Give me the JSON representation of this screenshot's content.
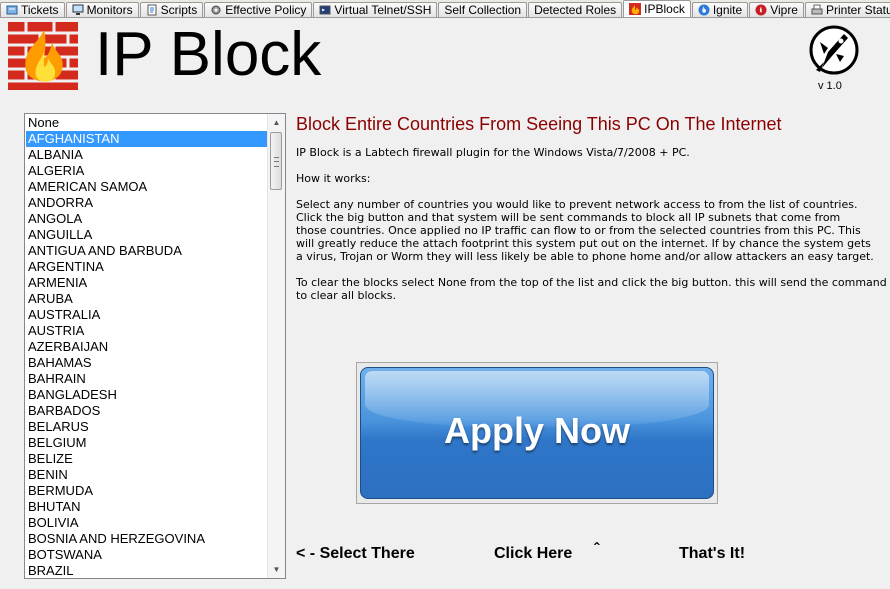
{
  "tabs": [
    {
      "label": "Tickets",
      "icon": "tickets-icon"
    },
    {
      "label": "Monitors",
      "icon": "monitors-icon"
    },
    {
      "label": "Scripts",
      "icon": "scripts-icon"
    },
    {
      "label": "Effective Policy",
      "icon": "policy-icon"
    },
    {
      "label": "Virtual Telnet/SSH",
      "icon": "terminal-icon"
    },
    {
      "label": "Self Collection",
      "icon": ""
    },
    {
      "label": "Detected Roles",
      "icon": ""
    },
    {
      "label": "IPBlock",
      "icon": "ipblock-icon",
      "active": true
    },
    {
      "label": "Ignite",
      "icon": "ignite-icon"
    },
    {
      "label": "Vipre",
      "icon": "vipre-icon"
    },
    {
      "label": "Printer Status",
      "icon": "printer-icon"
    }
  ],
  "header": {
    "title": "IP Block",
    "version": "v 1.0",
    "logo_icon": "firewall-flame-icon",
    "brand_icon": "rocket-emblem-icon"
  },
  "country_list": {
    "selected_index": 1,
    "items": [
      "None",
      "AFGHANISTAN",
      "ALBANIA",
      "ALGERIA",
      "AMERICAN SAMOA",
      "ANDORRA",
      "ANGOLA",
      "ANGUILLA",
      "ANTIGUA AND BARBUDA",
      "ARGENTINA",
      "ARMENIA",
      "ARUBA",
      "AUSTRALIA",
      "AUSTRIA",
      "AZERBAIJAN",
      "BAHAMAS",
      "BAHRAIN",
      "BANGLADESH",
      "BARBADOS",
      "BELARUS",
      "BELGIUM",
      "BELIZE",
      "BENIN",
      "BERMUDA",
      "BHUTAN",
      "BOLIVIA",
      "BOSNIA AND HERZEGOVINA",
      "BOTSWANA",
      "BRAZIL"
    ]
  },
  "panel": {
    "headline": "Block Entire Countries From Seeing This PC On The Internet",
    "intro": "IP Block is a Labtech firewall plugin for the Windows Vista/7/2008 + PC.",
    "how_title": "How it works:",
    "how_lines": [
      "Select any number of countries you would like to prevent network access to from the list of countries.",
      "Click the big button and that system will be sent commands to block all IP subnets that come from",
      "those countries. Once applied no IP traffic can flow to or from the selected countries from this PC. This",
      "will greatly reduce the attach footprint this system put out on the internet.  If by chance the system gets",
      "a virus, Trojan or Worm they will less likely be able to phone home and/or allow attackers an easy target."
    ],
    "clear_lines": [
      "To clear the blocks select None from the top of the list and click the big button. this will send the command",
      "to clear all blocks."
    ]
  },
  "apply_button": {
    "label": "Apply Now"
  },
  "hints": {
    "select": "< - Select There",
    "click": "Click Here",
    "caret": "ˆ",
    "done": "That's It!"
  },
  "colors": {
    "headline": "#8b0000",
    "selection": "#3399ff",
    "button": "#2f76c9"
  }
}
